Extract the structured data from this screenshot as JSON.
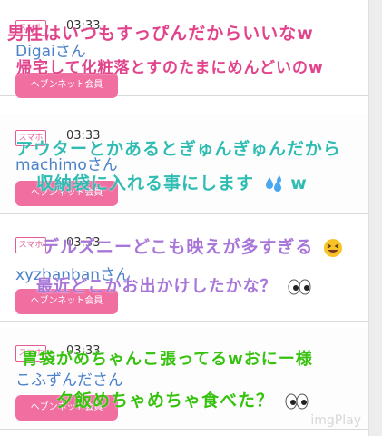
{
  "posts": [
    {
      "badge": "スマホ",
      "time": "03:33",
      "user": "Digaiさん",
      "member_label": "ヘブンネット会員",
      "overlay_lines": [
        "男性はいつもすっぴんだからいいなw",
        "帰宅して化粧落とすのたまにめんどいのw"
      ]
    },
    {
      "badge": "スマホ",
      "time": "03:33",
      "user": "machimoさん",
      "member_label": "ヘブンネット会員",
      "overlay_lines": [
        "アウターとかあるとぎゅんぎゅんだから",
        "収納袋に入れる事にします",
        "w"
      ]
    },
    {
      "badge": "スマホ",
      "time": "03:33",
      "user": "xyzbanbanさん",
      "member_label": "ヘブンネット会員",
      "overlay_lines": [
        "デルズニーどこも映えが多すぎる",
        "最近どこかお出かけしたかな？"
      ]
    },
    {
      "badge": "スマホ",
      "time": "03:33",
      "user": "こふずんださん",
      "member_label": "ヘブンネット会員",
      "overlay_lines": [
        "胃袋がめちゃんこ張ってるwおにー様",
        "夕飯めちゃめちゃ食べた？"
      ]
    }
  ],
  "watermark": "imgPlay",
  "colors": {
    "accent_pink": "#f06ea0",
    "badge_pink": "#e25c93",
    "username_blue": "#4b82c8"
  },
  "icons": [
    "droplets-emoji-icon",
    "grinning-squint-emoji-icon",
    "eyes-emoji-icon"
  ]
}
